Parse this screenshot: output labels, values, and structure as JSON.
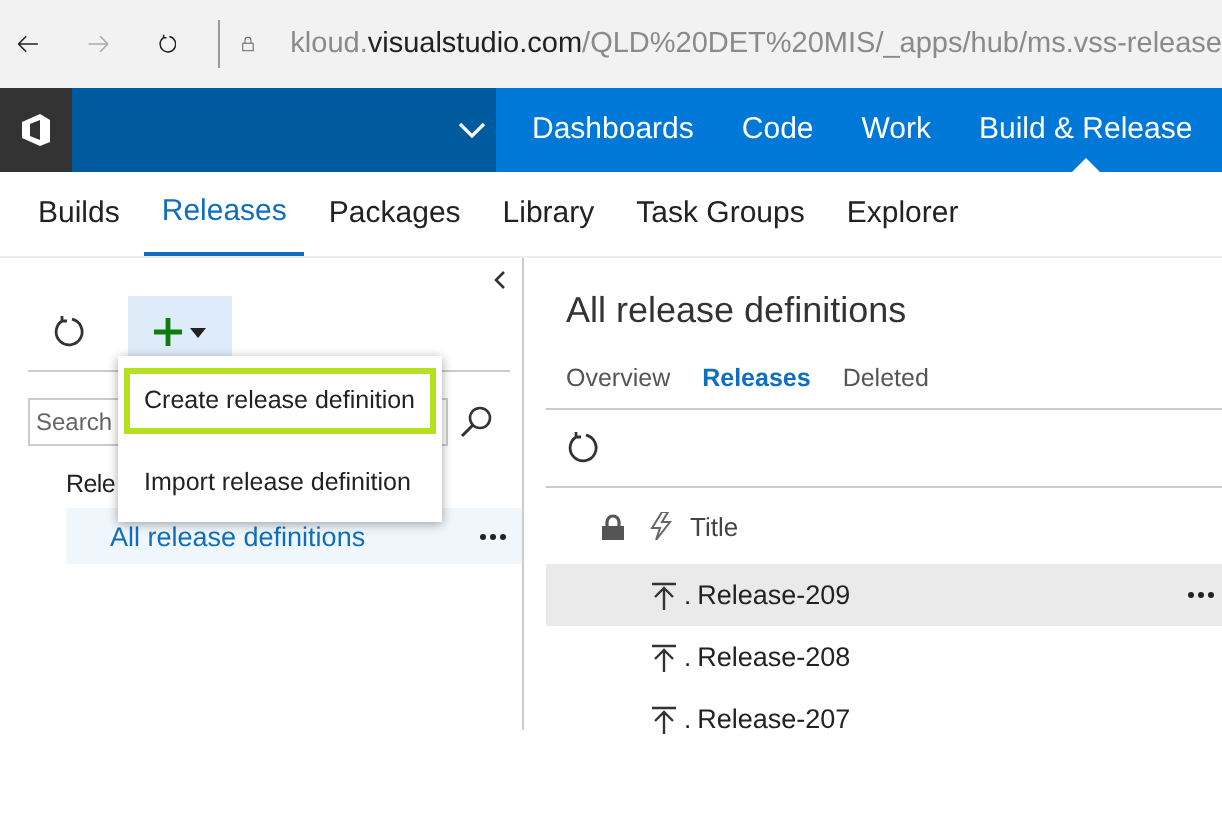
{
  "browser": {
    "url": {
      "subdomain": "kloud.",
      "domain": "visualstudio.com",
      "path": "/QLD%20DET%20MIS/_apps/hub/ms.vss-release"
    }
  },
  "top_nav": [
    {
      "label": "Dashboards",
      "selected": false
    },
    {
      "label": "Code",
      "selected": false
    },
    {
      "label": "Work",
      "selected": false
    },
    {
      "label": "Build & Release",
      "selected": true
    }
  ],
  "sub_tabs": [
    {
      "label": "Builds",
      "selected": false
    },
    {
      "label": "Releases",
      "selected": true
    },
    {
      "label": "Packages",
      "selected": false
    },
    {
      "label": "Library",
      "selected": false
    },
    {
      "label": "Task Groups",
      "selected": false
    },
    {
      "label": "Explorer",
      "selected": false
    }
  ],
  "sidebar": {
    "search": {
      "placeholder": "Search"
    },
    "section_label": "Rele",
    "items": [
      {
        "label": "All release definitions",
        "selected": true
      }
    ]
  },
  "add_menu": {
    "items": [
      {
        "label": "Create release definition",
        "highlighted": true
      },
      {
        "label": "Import release definition",
        "highlighted": false
      }
    ]
  },
  "main": {
    "title": "All release definitions",
    "tabs": [
      {
        "label": "Overview",
        "selected": false
      },
      {
        "label": "Releases",
        "selected": true
      },
      {
        "label": "Deleted",
        "selected": false
      }
    ],
    "table": {
      "columns": [
        "Title"
      ],
      "rows": [
        {
          "prefix": ".",
          "title": "Release-209",
          "selected": true
        },
        {
          "prefix": ".",
          "title": "Release-208",
          "selected": false
        },
        {
          "prefix": ".",
          "title": "Release-207",
          "selected": false
        }
      ]
    }
  }
}
